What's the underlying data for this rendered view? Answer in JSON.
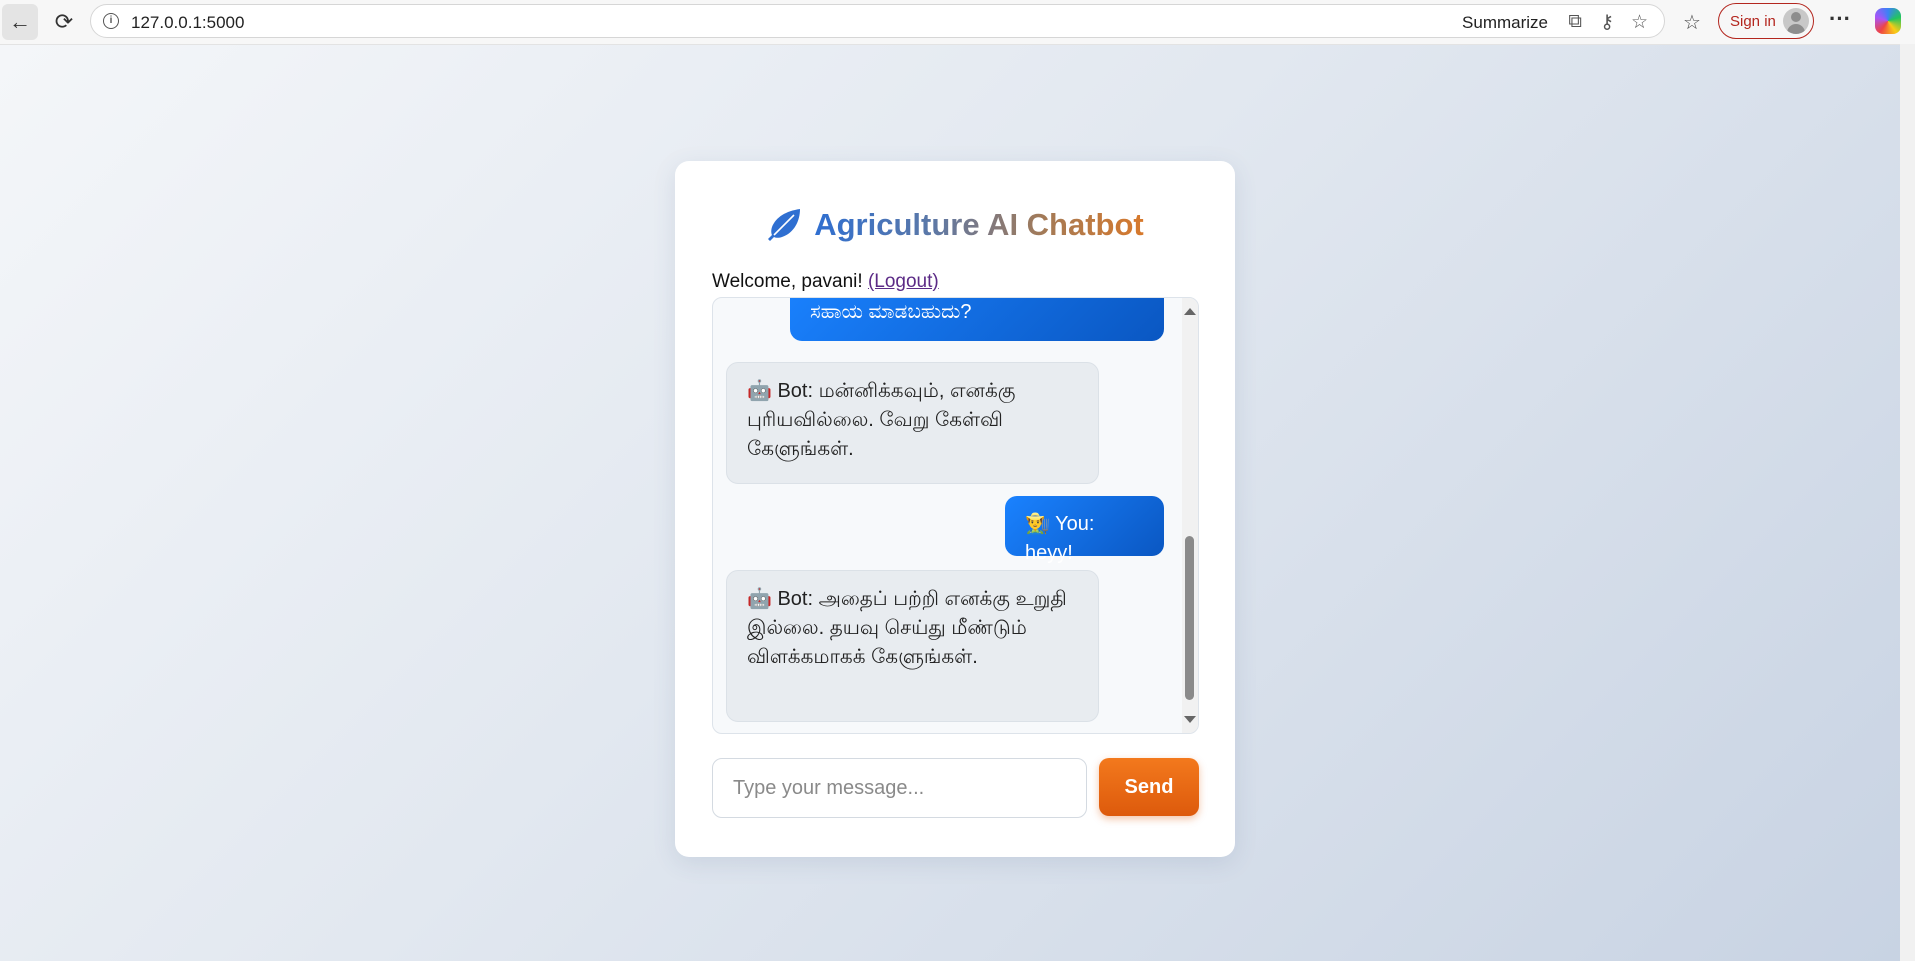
{
  "browser": {
    "url": "127.0.0.1:5000",
    "summarize_label": "Summarize",
    "sign_in_label": "Sign in",
    "more_label": "···"
  },
  "app": {
    "title": "Agriculture AI Chatbot",
    "welcome_text": "Welcome, pavani! ",
    "logout_label": "(Logout)"
  },
  "chat": {
    "messages": [
      {
        "sender": "user",
        "text": "ಸಹಾಯ ಮಾಡಬಹುದು?"
      },
      {
        "sender": "bot",
        "text": "🤖 Bot: மன்னிக்கவும், எனக்கு புரியவில்லை. வேறு கேள்வி கேளுங்கள்."
      },
      {
        "sender": "user",
        "text": "👨‍🌾 You: heyy!"
      },
      {
        "sender": "bot",
        "text": "🤖 Bot: அதைப் பற்றி எனக்கு உறுதி இல்லை. தயவு செய்து மீண்டும் விளக்கமாகக் கேளுங்கள்."
      }
    ]
  },
  "composer": {
    "placeholder": "Type your message...",
    "send_label": "Send"
  },
  "colors": {
    "user_bubble": "#1a82ff",
    "bot_bubble": "#e8ecf0",
    "send_button": "#f3791d",
    "logout_link": "#5b2a86"
  },
  "icons": {
    "title_icon": "leaf-icon",
    "bot_icon": "robot-emoji",
    "user_icon": "farmer-emoji"
  }
}
